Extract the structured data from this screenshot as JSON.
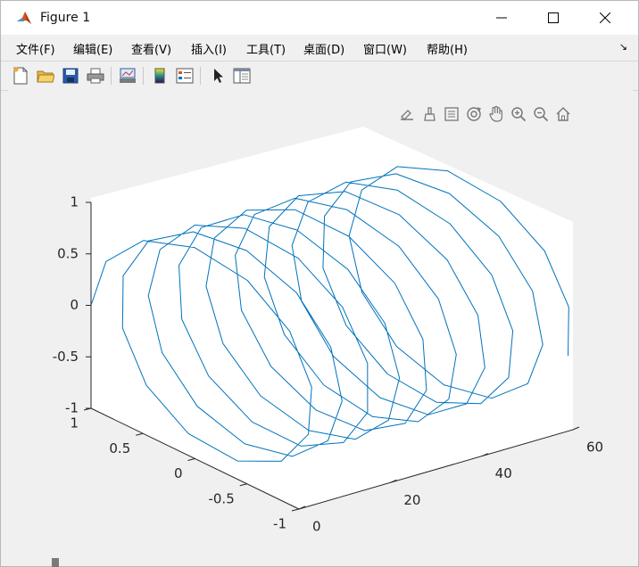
{
  "window": {
    "title": "Figure 1"
  },
  "menu": [
    {
      "label": "文件(F)"
    },
    {
      "label": "编辑(E)"
    },
    {
      "label": "查看(V)"
    },
    {
      "label": "插入(I)"
    },
    {
      "label": "工具(T)"
    },
    {
      "label": "桌面(D)"
    },
    {
      "label": "窗口(W)"
    },
    {
      "label": "帮助(H)"
    }
  ],
  "toolbar_icons": [
    "new-figure-icon",
    "open-file-icon",
    "save-icon",
    "print-icon",
    "link-plot-icon",
    "colorbar-icon",
    "legend-icon",
    "select-arrow-icon",
    "property-inspector-icon"
  ],
  "axes_toolbar_icons": [
    "export-icon",
    "brush-icon",
    "data-tips-icon",
    "rotate-3d-icon",
    "pan-icon",
    "zoom-in-icon",
    "zoom-out-icon",
    "restore-view-icon"
  ],
  "colors": {
    "line": "#0072bd",
    "axes_bg": "#ffffff",
    "figure_bg": "#f0f0f0"
  },
  "chart_data": {
    "type": "line",
    "projection": "3d",
    "description_of_curve": "helix: x = t, y = cos(t), z = sin(t)",
    "x_axis": {
      "range": [
        0,
        60
      ],
      "ticks": [
        "0",
        "20",
        "40",
        "60"
      ]
    },
    "y_axis": {
      "range": [
        -1,
        1
      ],
      "ticks": [
        "-1",
        "-0.5",
        "0",
        "0.5",
        "1"
      ]
    },
    "z_axis": {
      "range": [
        -1,
        1
      ],
      "ticks": [
        "-1",
        "-0.5",
        "0",
        "0.5",
        "1"
      ]
    },
    "t_range": [
      0,
      60
    ],
    "t_step": 0.5,
    "title": "",
    "xlabel": "",
    "ylabel": "",
    "zlabel": "",
    "grid": false,
    "legend": "none"
  }
}
